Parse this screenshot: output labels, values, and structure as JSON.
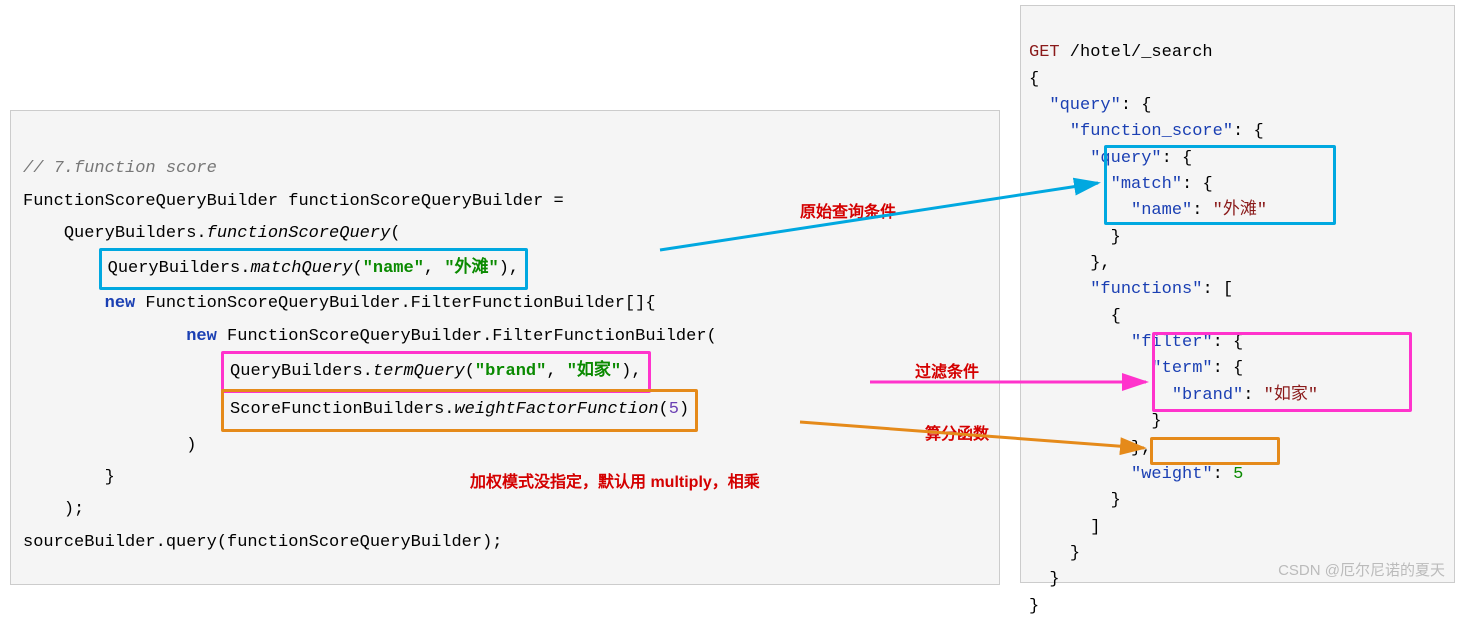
{
  "left": {
    "comment": "// 7.function score",
    "l1_a": "FunctionScoreQueryBuilder functionScoreQueryBuilder =",
    "l2_a": "QueryBuilders.",
    "l2_b": "functionScoreQuery",
    "l2_c": "(",
    "box1_a": "QueryBuilders.",
    "box1_b": "matchQuery",
    "box1_c": "(",
    "box1_d": "\"name\"",
    "box1_e": ", ",
    "box1_f": "\"外滩\"",
    "box1_g": "),",
    "l4_kw": "new",
    "l4_a": " FunctionScoreQueryBuilder.FilterFunctionBuilder[]{",
    "l5_kw": "new",
    "l5_a": " FunctionScoreQueryBuilder.FilterFunctionBuilder(",
    "box2_a": "QueryBuilders.",
    "box2_b": "termQuery",
    "box2_c": "(",
    "box2_d": "\"brand\"",
    "box2_e": ", ",
    "box2_f": "\"如家\"",
    "box2_g": "),",
    "box3_a": "ScoreFunctionBuilders.",
    "box3_b": "weightFactorFunction",
    "box3_c": "(",
    "box3_d": "5",
    "box3_e": ")",
    "l6": ")",
    "l7": "}",
    "l8": ");",
    "l9": "sourceBuilder.query(functionScoreQueryBuilder);"
  },
  "annot": {
    "a1": "原始查询条件",
    "a2": "过滤条件",
    "a3": "算分函数",
    "a4": "加权模式没指定，默认用 multiply，相乘"
  },
  "right": {
    "r0a": "GET",
    "r0b": " /hotel/_search",
    "r1": "{",
    "r2a": "\"query\"",
    "r2b": ": {",
    "r3a": "\"function_score\"",
    "r3b": ": {",
    "r4a": "\"query\"",
    "r4b": ": {",
    "r5a": "\"match\"",
    "r5b": ": {",
    "r6a": "\"name\"",
    "r6b": ": ",
    "r6c": "\"外滩\"",
    "r7": "}",
    "r8": "},",
    "r9a": "\"functions\"",
    "r9b": ": [",
    "r10": "{",
    "r11a": "\"filter\"",
    "r11b": ": {",
    "r12a": "\"term\"",
    "r12b": ": {",
    "r13a": "\"brand\"",
    "r13b": ": ",
    "r13c": "\"如家\"",
    "r14": "}",
    "r15": "},",
    "r16a": "\"weight\"",
    "r16b": ": ",
    "r16c": "5",
    "r17": "}",
    "r18": "]",
    "r19": "}",
    "r20": "}",
    "r21": "}"
  },
  "watermark": "CSDN @厄尔尼诺的夏天",
  "colors": {
    "cyan": "#00a8e0",
    "pink": "#ff33cc",
    "orange": "#e58a1a",
    "red": "#d40000"
  }
}
